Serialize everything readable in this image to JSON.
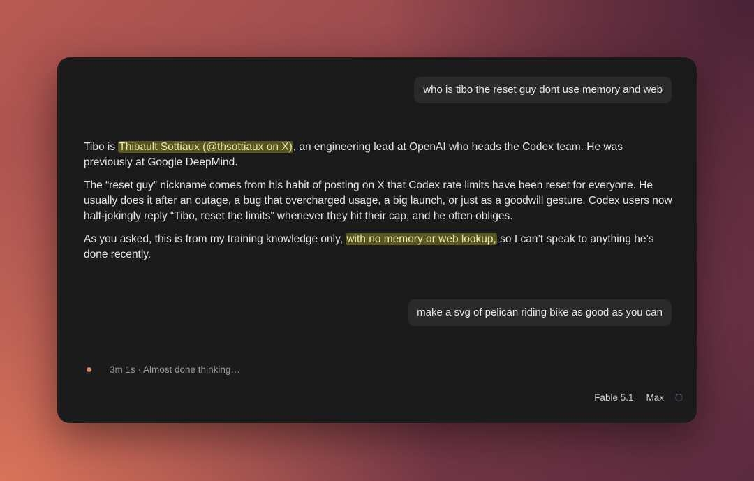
{
  "conversation": {
    "user_messages": [
      "who is tibo the reset guy dont use memory and web",
      "make a svg of pelican riding bike as good as you can"
    ],
    "assistant": {
      "p1_before": "Tibo is ",
      "p1_highlight": "Thibault Sottiaux (@thsottiaux on X)",
      "p1_after": ", an engineering lead at OpenAI who heads the Codex team. He was previously at Google DeepMind.",
      "p2": "The “reset guy” nickname comes from his habit of posting on X that Codex rate limits have been reset for everyone. He usually does it after an outage, a bug that overcharged usage, a big launch, or just as a goodwill gesture. Codex users now half-jokingly reply “Tibo, reset the limits” whenever they hit their cap, and he often obliges.",
      "p3_before": "As you asked, this is from my training knowledge only, ",
      "p3_highlight": "with no memory or web lookup,",
      "p3_after": " so I can’t speak to anything he’s done recently."
    }
  },
  "status": {
    "text": "3m 1s · Almost done thinking…",
    "dot_color": "#d98a5e"
  },
  "footer": {
    "model": "Fable 5.1",
    "mode": "Max"
  },
  "colors": {
    "window_bg": "#1b1b1b",
    "bubble_bg": "#2a2a2a",
    "highlight": "#8c8728"
  }
}
